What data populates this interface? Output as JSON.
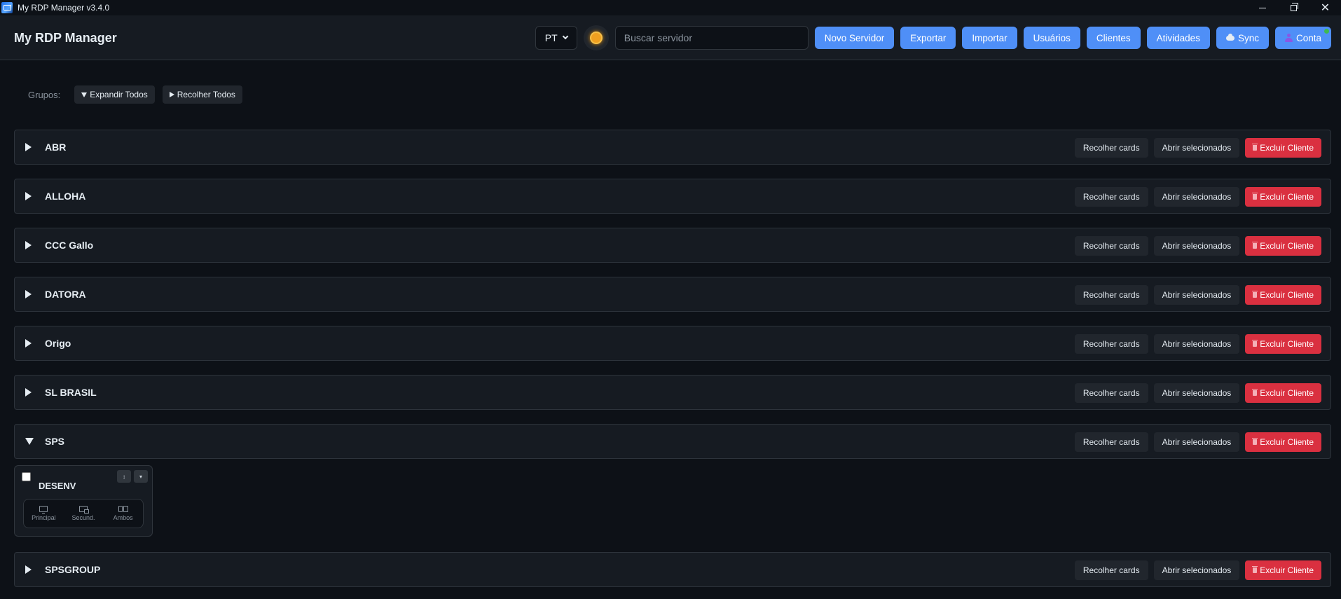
{
  "window": {
    "title": "My RDP Manager v3.4.0",
    "controls": {
      "minimize": "minimize-icon",
      "maximize": "restore-icon",
      "close": "✕"
    }
  },
  "header": {
    "app_title": "My RDP Manager",
    "language": "PT",
    "search_placeholder": "Buscar servidor",
    "buttons": {
      "new_server": "Novo Servidor",
      "export": "Exportar",
      "import": "Importar",
      "users": "Usuários",
      "clients": "Clientes",
      "activities": "Atividades",
      "sync": "Sync",
      "account": "Conta"
    },
    "colors": {
      "primary_button": "#4f8ff7",
      "account_status": "#3fb950"
    }
  },
  "groups_bar": {
    "label": "Grupos:",
    "expand_all": "Expandir Todos",
    "collapse_all": "Recolher Todos"
  },
  "group_actions": {
    "collapse_cards": "Recolher cards",
    "open_selected": "Abrir selecionados",
    "delete_client": "Excluir Cliente",
    "delete_color": "#da3040"
  },
  "groups": [
    {
      "name": "ABR",
      "expanded": false
    },
    {
      "name": "ALLOHA",
      "expanded": false
    },
    {
      "name": "CCC Gallo",
      "expanded": false
    },
    {
      "name": "DATORA",
      "expanded": false
    },
    {
      "name": "Origo",
      "expanded": false
    },
    {
      "name": "SL BRASIL",
      "expanded": false
    },
    {
      "name": "SPS",
      "expanded": true
    },
    {
      "name": "SPSGROUP",
      "expanded": false
    }
  ],
  "server_card": {
    "name": "DESENV",
    "checked": false,
    "mini_buttons": [
      "↕",
      "▾"
    ],
    "connect_options": [
      "Principal",
      "Secund.",
      "Ambos"
    ]
  }
}
